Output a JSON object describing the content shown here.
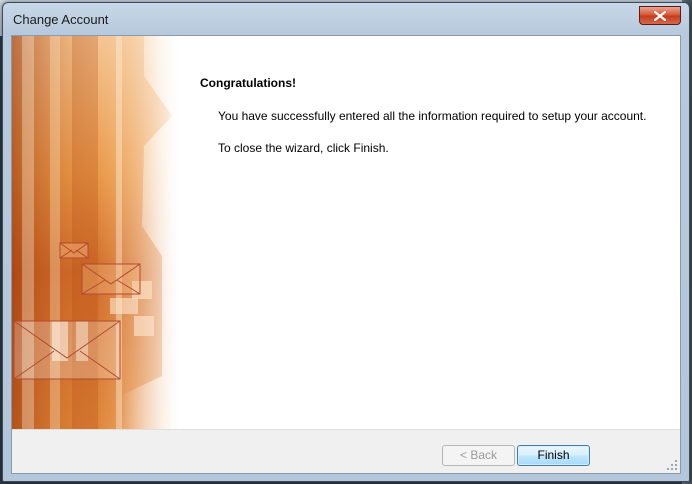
{
  "window": {
    "title": "Change Account"
  },
  "wizard": {
    "heading": "Congratulations!",
    "message": "You have successfully entered all the information required to setup your account.",
    "instruction": "To close the wizard, click Finish."
  },
  "buttons": {
    "back_label": "< Back",
    "finish_label": "Finish",
    "back_enabled": false
  },
  "icons": {
    "close": "close-icon",
    "envelope": "envelope-icon"
  },
  "colors": {
    "banner_orange": "#e07a1f",
    "close_red": "#c33b1c",
    "button_border": "#3c7fb1"
  }
}
